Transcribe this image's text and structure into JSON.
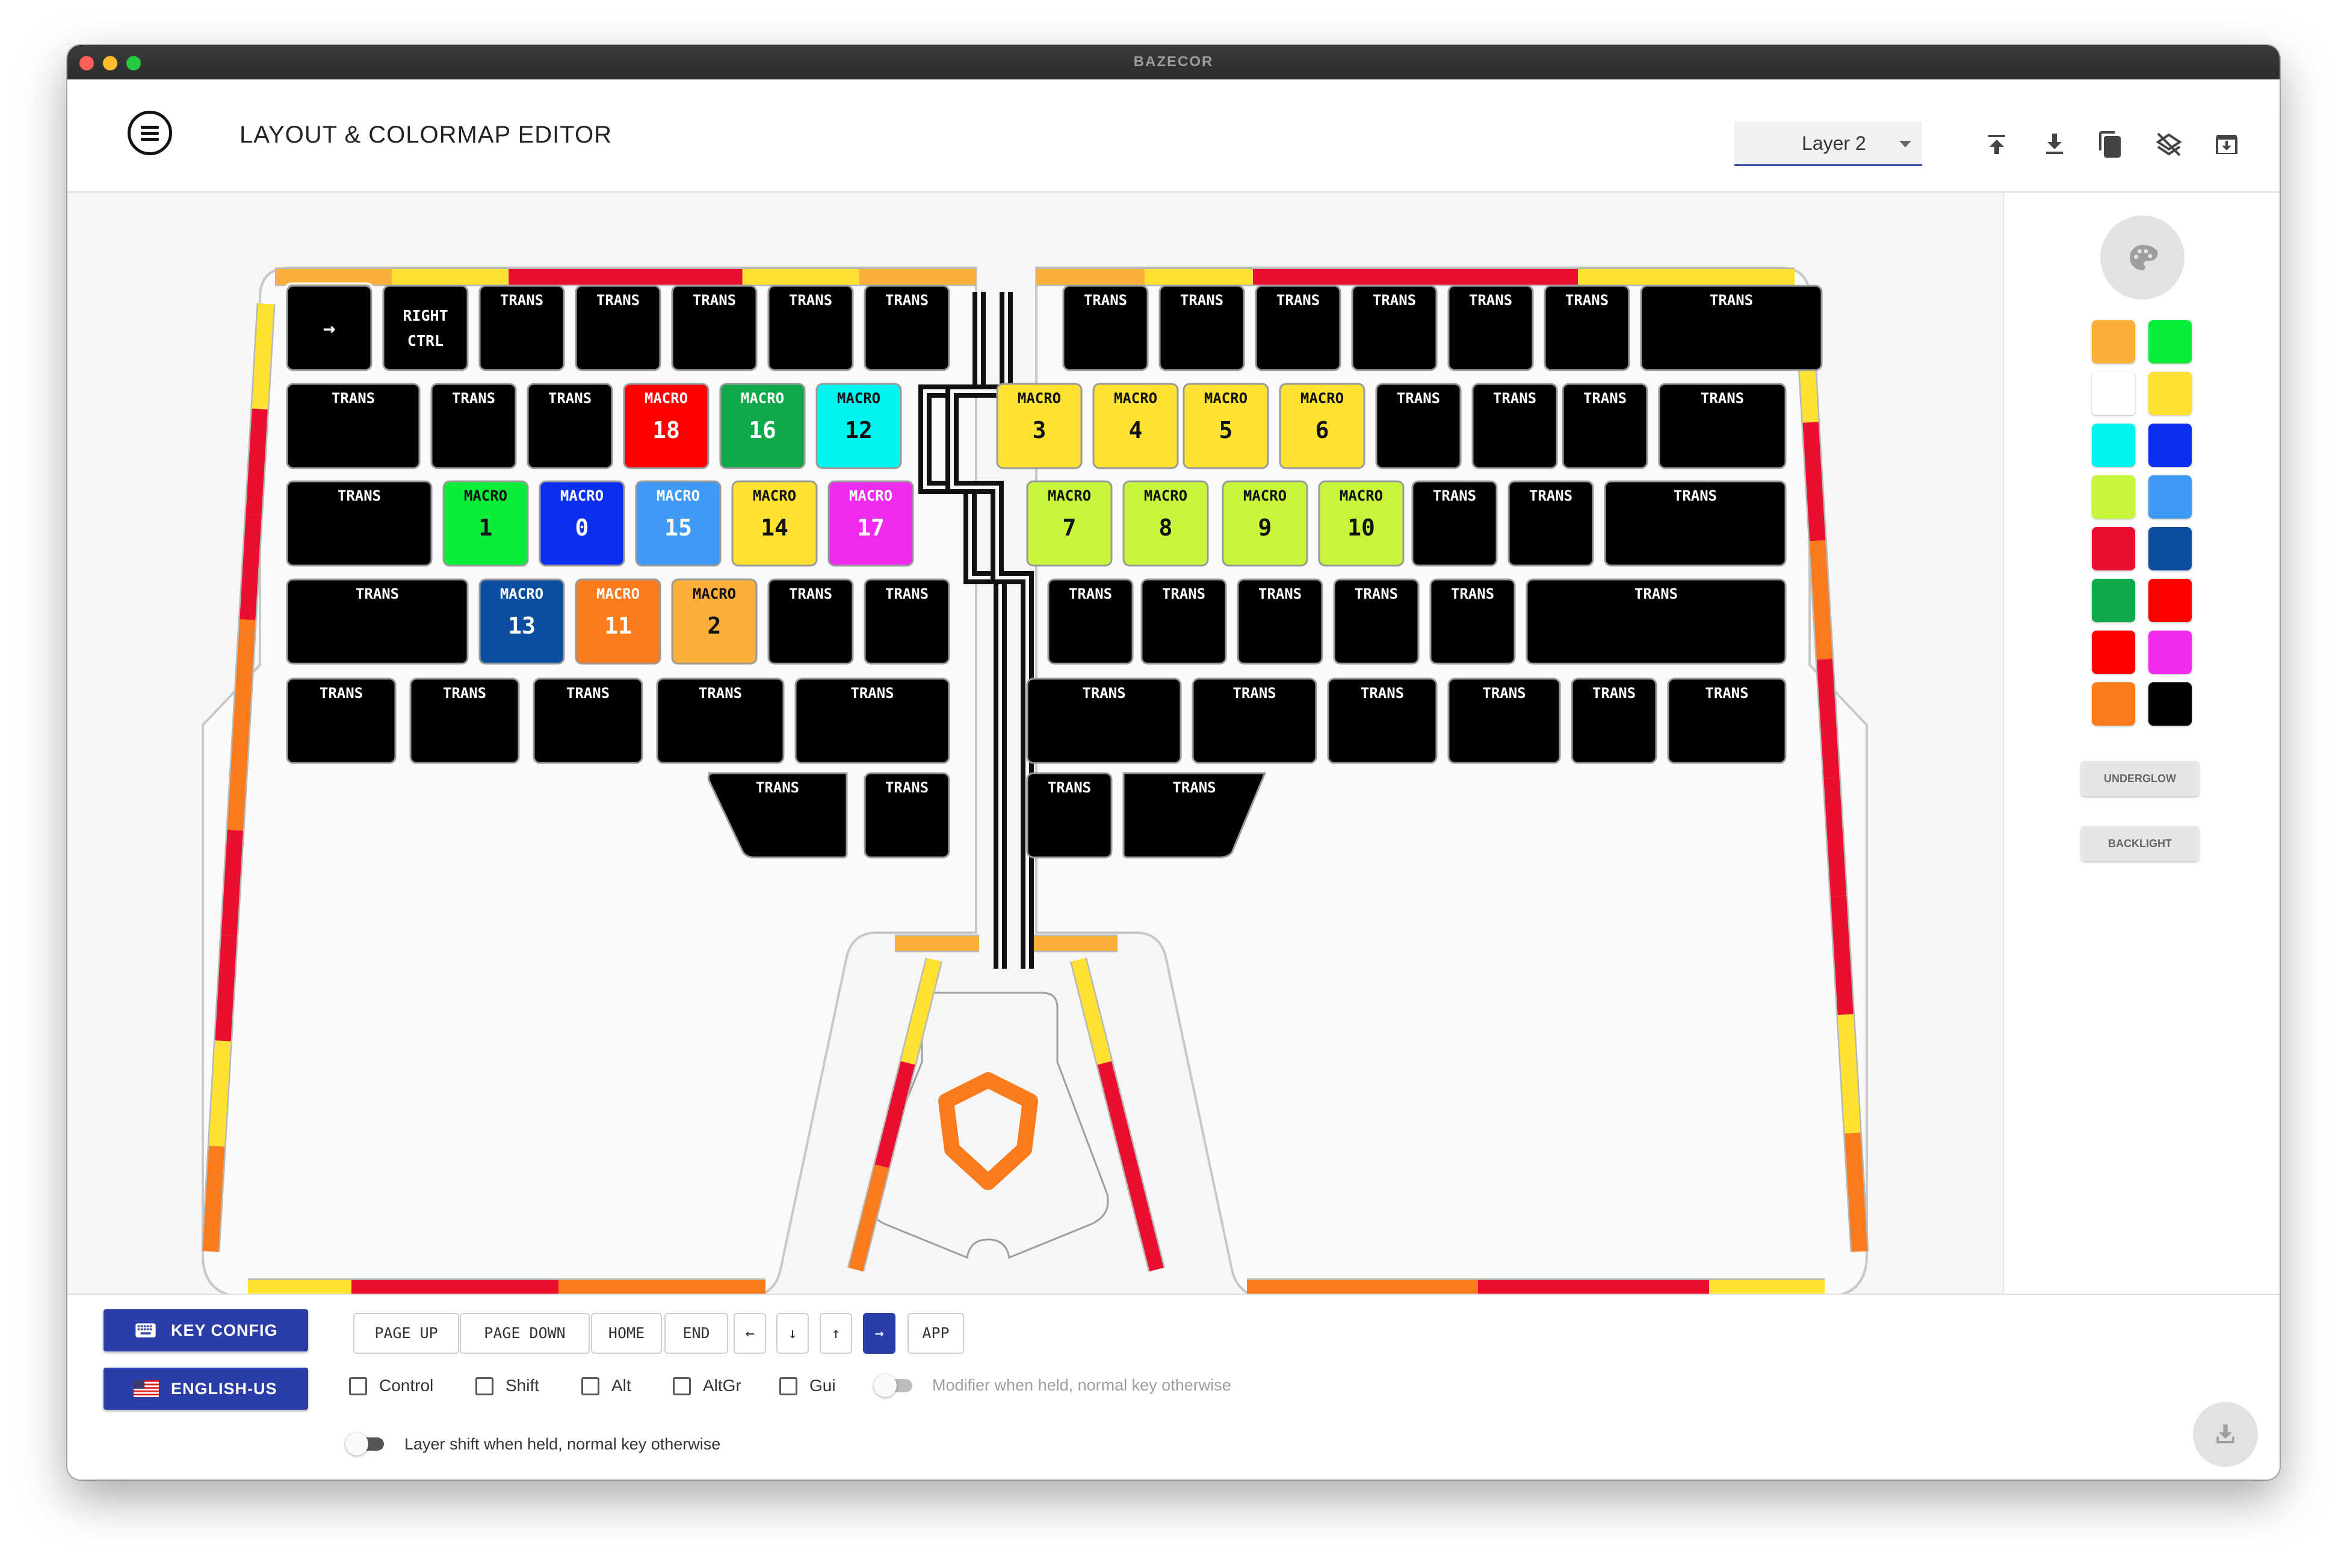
{
  "window": {
    "title": "BAZECOR"
  },
  "header": {
    "title": "LAYOUT & COLORMAP EDITOR",
    "layer": "Layer 2"
  },
  "toolbar_icons": [
    "upload-icon",
    "download-icon",
    "copy-icon",
    "clear-layer-icon",
    "archive-icon"
  ],
  "keyboard": {
    "left": [
      [
        {
          "t": "→"
        },
        {
          "t": "RIGHT",
          "b": "CTRL"
        },
        {
          "t": "TRANS"
        },
        {
          "t": "TRANS"
        },
        {
          "t": "TRANS"
        },
        {
          "t": "TRANS"
        },
        {
          "t": "TRANS"
        }
      ],
      [
        {
          "t": "TRANS"
        },
        {
          "t": "TRANS"
        },
        {
          "t": "TRANS"
        },
        {
          "t": "MACRO",
          "b": "18",
          "c": "#ff0000"
        },
        {
          "t": "MACRO",
          "b": "16",
          "c": "#0fa84a"
        },
        {
          "t": "MACRO",
          "b": "12",
          "c": "#00f5f0"
        }
      ],
      [
        {
          "t": "TRANS"
        },
        {
          "t": "MACRO",
          "b": "1",
          "c": "#0aee3a"
        },
        {
          "t": "MACRO",
          "b": "0",
          "c": "#0a2ff0"
        },
        {
          "t": "MACRO",
          "b": "15",
          "c": "#3f9af5"
        },
        {
          "t": "MACRO",
          "b": "14",
          "c": "#fde233"
        },
        {
          "t": "MACRO",
          "b": "17",
          "c": "#f02bf0"
        }
      ],
      [
        {
          "t": "TRANS"
        },
        {
          "t": "MACRO",
          "b": "13",
          "c": "#0b4ea0"
        },
        {
          "t": "MACRO",
          "b": "11",
          "c": "#fa7a1e"
        },
        {
          "t": "MACRO",
          "b": "2",
          "c": "#fbb03b"
        },
        {
          "t": "TRANS"
        },
        {
          "t": "TRANS"
        }
      ],
      [
        {
          "t": "TRANS"
        },
        {
          "t": "TRANS"
        },
        {
          "t": "TRANS"
        },
        {
          "t": "TRANS"
        },
        {
          "t": "TRANS"
        }
      ],
      [
        {
          "t": "TRANS"
        },
        {
          "t": "TRANS"
        }
      ]
    ],
    "right": [
      [
        {
          "t": "TRANS"
        },
        {
          "t": "TRANS"
        },
        {
          "t": "TRANS"
        },
        {
          "t": "TRANS"
        },
        {
          "t": "TRANS"
        },
        {
          "t": "TRANS"
        },
        {
          "t": "TRANS"
        }
      ],
      [
        {
          "t": "MACRO",
          "b": "3",
          "c": "#fde233"
        },
        {
          "t": "MACRO",
          "b": "4",
          "c": "#fde233"
        },
        {
          "t": "MACRO",
          "b": "5",
          "c": "#fde233"
        },
        {
          "t": "MACRO",
          "b": "6",
          "c": "#fde233"
        },
        {
          "t": "TRANS"
        },
        {
          "t": "TRANS"
        },
        {
          "t": "TRANS"
        },
        {
          "t": "TRANS"
        }
      ],
      [
        {
          "t": "MACRO",
          "b": "7",
          "c": "#c6f53a"
        },
        {
          "t": "MACRO",
          "b": "8",
          "c": "#c6f53a"
        },
        {
          "t": "MACRO",
          "b": "9",
          "c": "#c6f53a"
        },
        {
          "t": "MACRO",
          "b": "10",
          "c": "#c6f53a"
        },
        {
          "t": "TRANS"
        },
        {
          "t": "TRANS"
        },
        {
          "t": "TRANS"
        }
      ],
      [
        {
          "t": "TRANS"
        },
        {
          "t": "TRANS"
        },
        {
          "t": "TRANS"
        },
        {
          "t": "TRANS"
        },
        {
          "t": "TRANS"
        },
        {
          "t": "TRANS"
        }
      ],
      [
        {
          "t": "TRANS"
        },
        {
          "t": "TRANS"
        },
        {
          "t": "TRANS"
        },
        {
          "t": "TRANS"
        },
        {
          "t": "TRANS"
        },
        {
          "t": "TRANS"
        }
      ],
      [
        {
          "t": "TRANS"
        },
        {
          "t": "TRANS"
        }
      ]
    ]
  },
  "underglow_colors": {
    "left_top": [
      "#fbb03b",
      "#fde233",
      "#ea0f2f",
      "#ea0f2f",
      "#fde233",
      "#fbb03b"
    ],
    "right_top": [
      "#fbb03b",
      "#fde233",
      "#ea0f2f",
      "#ea0f2f",
      "#ea0f2f",
      "#fde233",
      "#fde233"
    ],
    "left_side": [
      "#fde233",
      "#ea0f2f",
      "#ea0f2f",
      "#fa7a1e",
      "#fa7a1e",
      "#ea0f2f",
      "#ea0f2f",
      "#fde233",
      "#fa7a1e"
    ],
    "left_bottom": [
      "#fde233",
      "#ea0f2f",
      "#ea0f2f",
      "#fa7a1e",
      "#fa7a1e"
    ],
    "right_side": [
      "#fde233",
      "#ea0f2f",
      "#fa7a1e",
      "#ea0f2f",
      "#ea0f2f",
      "#ea0f2f",
      "#fde233",
      "#fa7a1e"
    ],
    "right_bottom": [
      "#fa7a1e",
      "#fa7a1e",
      "#ea0f2f",
      "#ea0f2f",
      "#fde233"
    ],
    "thumb": [
      "#fde233",
      "#ea0f2f",
      "#fa7a1e",
      "#fbb03b",
      "#fbb03b",
      "#fde233",
      "#ea0f2f",
      "#ea0f2f"
    ]
  },
  "palette": {
    "colors": [
      "#fbb03b",
      "#0aee3a",
      "#ffffff",
      "#fde233",
      "#00f5f0",
      "#0a2ff0",
      "#c6f53a",
      "#3f9af5",
      "#ea0f2f",
      "#0b4ea0",
      "#0fa84a",
      "#ff0000",
      "#ff0000",
      "#f02bf0",
      "#fa7a1e",
      "#000000"
    ],
    "underglow_label": "UNDERGLOW",
    "backlight_label": "BACKLIGHT"
  },
  "bottom": {
    "key_config": "KEY CONFIG",
    "language": "ENGLISH-US",
    "keys": [
      "PAGE UP",
      "PAGE DOWN",
      "HOME",
      "END",
      "←",
      "↓",
      "↑",
      "→",
      "APP"
    ],
    "active_key": "→",
    "modifiers": [
      "Control",
      "Shift",
      "Alt",
      "AltGr",
      "Gui"
    ],
    "modifier_toggle_label": "Modifier when held, normal key otherwise",
    "layer_toggle_label": "Layer shift when held, normal key otherwise"
  }
}
